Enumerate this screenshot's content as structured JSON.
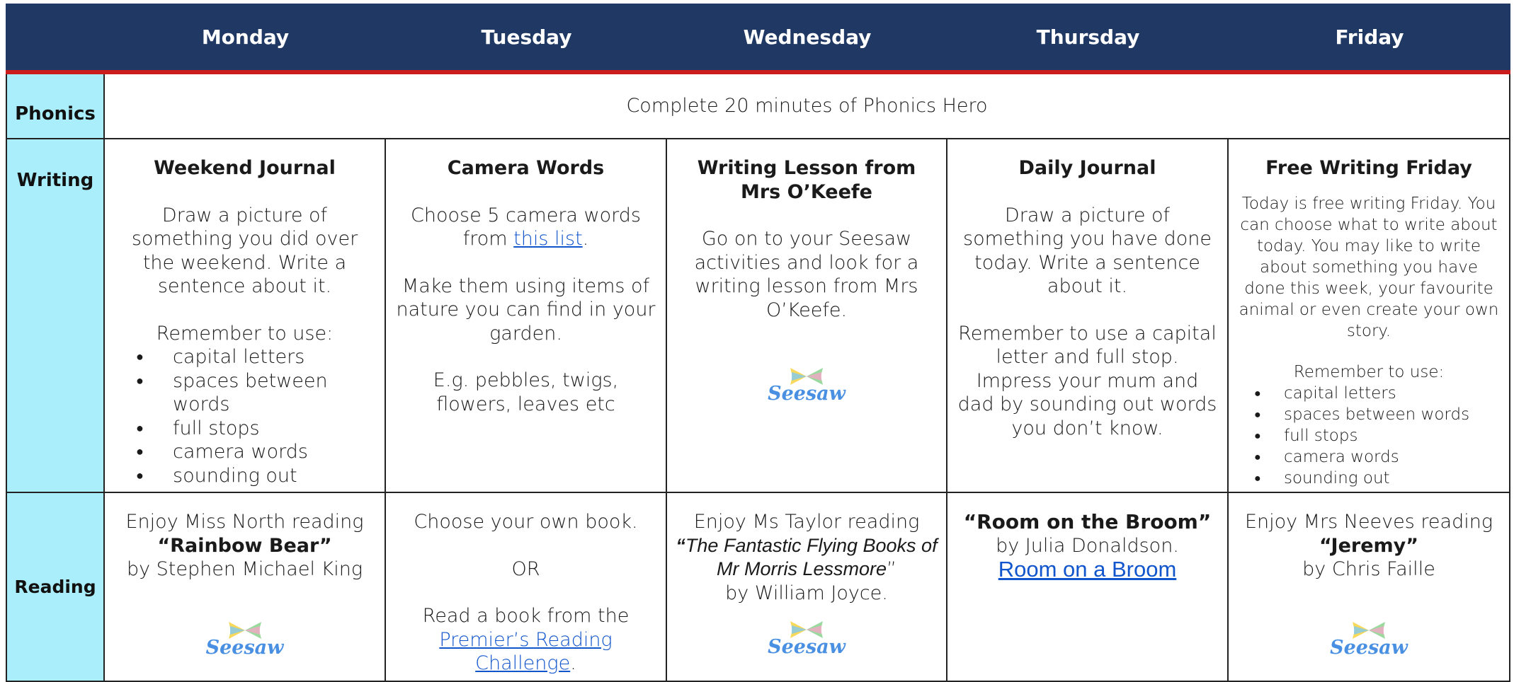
{
  "days": [
    "Monday",
    "Tuesday",
    "Wednesday",
    "Thursday",
    "Friday"
  ],
  "rows": {
    "phonics": "Phonics",
    "writing": "Writing",
    "reading": "Reading"
  },
  "phonics_task": "Complete 20 minutes of Phonics Hero",
  "writing": {
    "monday": {
      "title": "Weekend Journal",
      "text": "Draw a picture of something you did over the weekend. Write a sentence about it.",
      "remember": "Remember to use:",
      "bullets": [
        "capital letters",
        "spaces between words",
        "full stops",
        "camera words",
        "sounding out"
      ]
    },
    "tuesday": {
      "title": "Camera Words",
      "text_before": "Choose 5 camera words from ",
      "link": "this list",
      "text_after": ".",
      "para2": "Make them using items of nature you can find in your garden.",
      "para3": "E.g. pebbles, twigs, flowers, leaves etc"
    },
    "wednesday": {
      "title": "Writing Lesson from Mrs O’Keefe",
      "text": "Go on to your Seesaw activities and look for a writing lesson from Mrs O’Keefe.",
      "logo": "Seesaw"
    },
    "thursday": {
      "title": "Daily Journal",
      "text": "Draw a picture of something you have done today. Write a sentence about it.",
      "para2": "Remember to use a capital letter and full stop. Impress your mum and dad by sounding out words you don’t know."
    },
    "friday": {
      "title": "Free Writing Friday",
      "text": "Today is free writing Friday. You can choose what to write about today. You may like to write about something you have done this week, your favourite animal or even create your own story.",
      "remember": "Remember to use:",
      "bullets": [
        "capital letters",
        "spaces between words",
        "full stops",
        "camera words",
        "sounding out"
      ]
    }
  },
  "reading": {
    "monday": {
      "line1": "Enjoy Miss North reading",
      "book": "“Rainbow Bear”",
      "author": "by Stephen Michael King",
      "logo": "Seesaw"
    },
    "tuesday": {
      "line1": "Choose your own book.",
      "or": "OR",
      "line2": "Read a book from the",
      "link": "Premier’s Reading Challenge",
      "after": "."
    },
    "wednesday": {
      "line1": "Enjoy Ms Taylor reading",
      "book_open": "“",
      "book": "The Fantastic Flying Books of Mr Morris Lessmore",
      "book_close": "”",
      "author": "by William Joyce.",
      "logo": "Seesaw"
    },
    "thursday": {
      "book": "“Room on the Broom”",
      "author": "by Julia Donaldson.",
      "link": "Room on a Broom"
    },
    "friday": {
      "line1": "Enjoy Mrs Neeves reading",
      "book": "“Jeremy”",
      "author": "by Chris Faille",
      "logo": "Seesaw"
    }
  },
  "colors": {
    "header_bg": "#1f3864",
    "header_rule": "#cc1b1b",
    "side_bg": "#a9eefa",
    "link": "#1155cc",
    "seesaw_blue": "#4a90e2"
  }
}
